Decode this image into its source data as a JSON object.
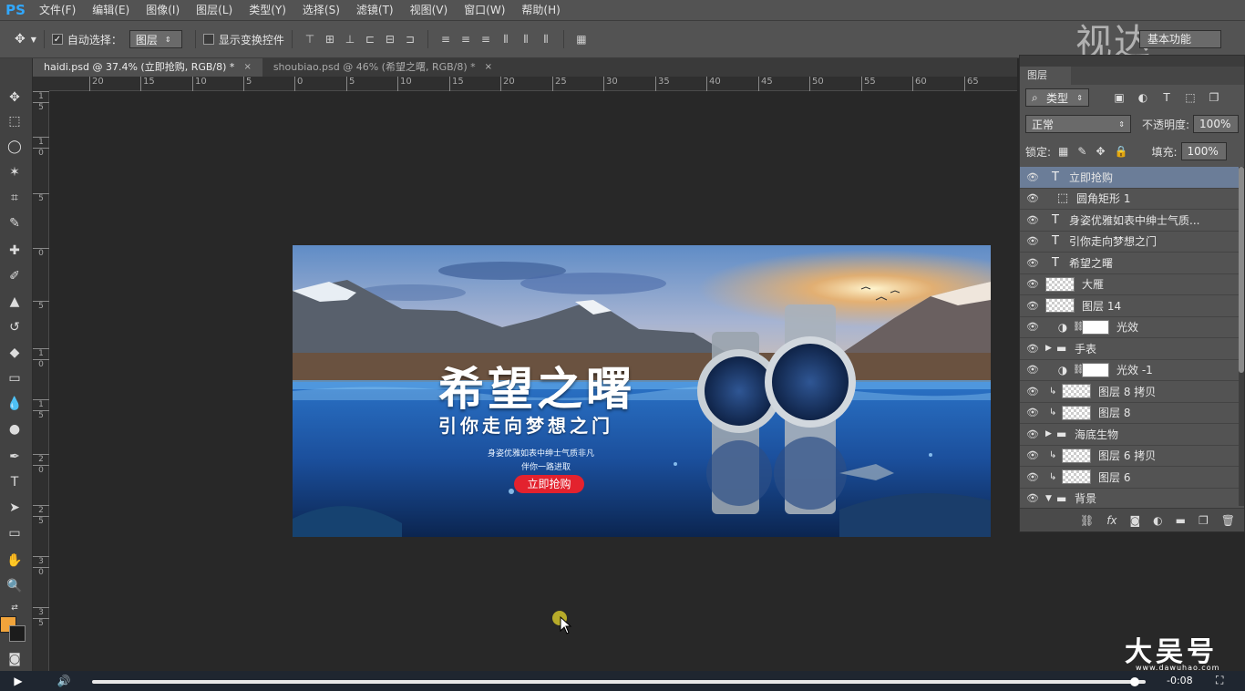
{
  "app": {
    "logo": "PS"
  },
  "menu": [
    "文件(F)",
    "编辑(E)",
    "图像(I)",
    "图层(L)",
    "类型(Y)",
    "选择(S)",
    "滤镜(T)",
    "视图(V)",
    "窗口(W)",
    "帮助(H)"
  ],
  "options": {
    "auto_select_label": "自动选择：",
    "auto_select_checked": true,
    "auto_select_value": "图层",
    "show_transform_label": "显示变换控件",
    "workspace_value": "基本功能"
  },
  "tabs": [
    {
      "label": "haidi.psd @ 37.4% (立即抢购, RGB/8) *",
      "close": "×",
      "active": true
    },
    {
      "label": "shoubiao.psd @ 46% (希望之曙, RGB/8) *",
      "close": "×",
      "active": false
    }
  ],
  "ruler_h": [
    "20",
    "15",
    "10",
    "5",
    "0",
    "5",
    "10",
    "15",
    "20",
    "25",
    "30",
    "35",
    "40",
    "45",
    "50",
    "55",
    "60",
    "65"
  ],
  "ruler_v": [
    "1",
    "5",
    "1",
    "0",
    "5",
    "0",
    "5",
    "1",
    "0",
    "1",
    "5",
    "2",
    "0",
    "2",
    "5",
    "3",
    "0",
    "3",
    "5"
  ],
  "banner": {
    "headline": "希望之曙",
    "subline": "引你走向梦想之门",
    "desc1": "身姿优雅如表中绅士气质非凡",
    "desc2": "伴你一路进取",
    "cta": "立即抢购"
  },
  "layers_panel": {
    "title": "图层",
    "filter_kind": "类型",
    "blend_mode": "正常",
    "opacity_label": "不透明度:",
    "opacity_value": "100%",
    "lock_label": "锁定:",
    "fill_label": "填充:",
    "fill_value": "100%",
    "layers": [
      {
        "name": "立即抢购",
        "kind": "text",
        "selected": true
      },
      {
        "name": "圆角矩形 1",
        "kind": "shape"
      },
      {
        "name": "身姿优雅如表中绅士气质...",
        "kind": "text"
      },
      {
        "name": "引你走向梦想之门",
        "kind": "text"
      },
      {
        "name": "希望之曙",
        "kind": "text"
      },
      {
        "name": "大雁",
        "kind": "pixel"
      },
      {
        "name": "图层 14",
        "kind": "pixel"
      },
      {
        "name": "光效",
        "kind": "adjustment"
      },
      {
        "name": "手表",
        "kind": "group"
      },
      {
        "name": "光效 -1",
        "kind": "adjustment"
      },
      {
        "name": "图层 8 拷贝",
        "kind": "clipped"
      },
      {
        "name": "图层 8",
        "kind": "clipped"
      },
      {
        "name": "海底生物",
        "kind": "group"
      },
      {
        "name": "图层 6 拷贝",
        "kind": "clipped"
      },
      {
        "name": "图层 6",
        "kind": "clipped"
      },
      {
        "name": "背景",
        "kind": "group"
      }
    ]
  },
  "player": {
    "time_remaining": "-0:08",
    "progress": 0.99
  },
  "watermarks": {
    "top": "视达",
    "bottom": "大吴号",
    "bottom_url": "www.dawuhao.com"
  },
  "colors": {
    "foreground": "#f1a43b",
    "background": "#1c1c1c",
    "selected_layer": "#6b7d98",
    "cta": "#e3222e"
  }
}
